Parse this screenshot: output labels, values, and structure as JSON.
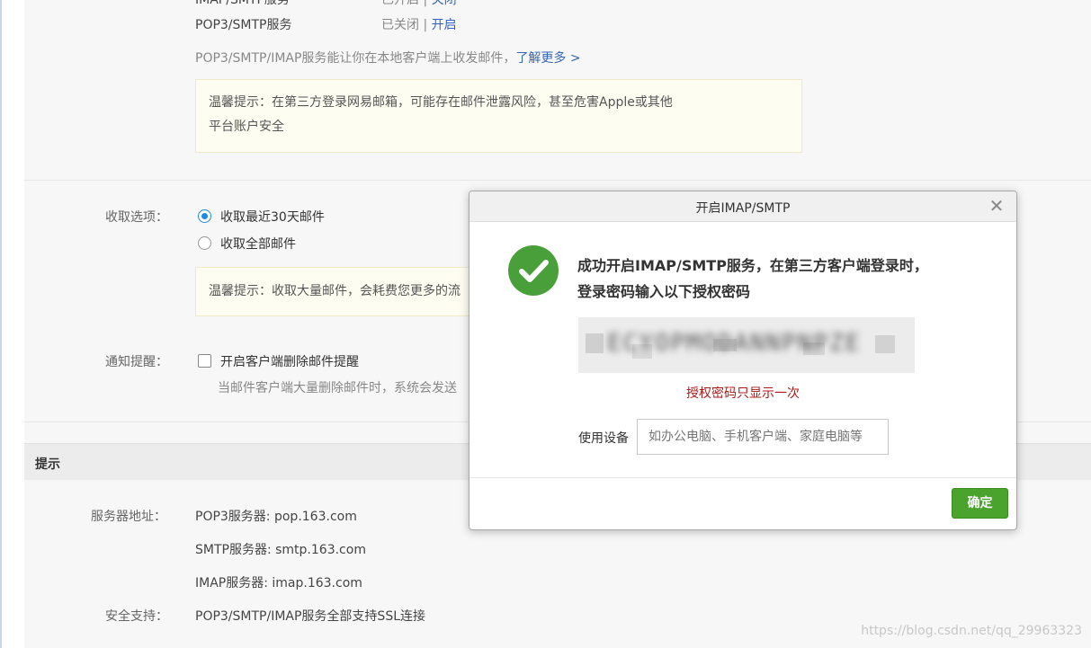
{
  "settings": {
    "partial_row": {
      "name": "IMAP/SMTP服务",
      "status": "已开启",
      "action": "关闭"
    },
    "pop3_row": {
      "name": "POP3/SMTP服务",
      "status": "已关闭",
      "divider": "|",
      "action": "开启"
    },
    "service_desc": "POP3/SMTP/IMAP服务能让你在本地客户端上收发邮件，",
    "learn_more": "了解更多 >",
    "tip1_line1": "温馨提示：在第三方登录网易邮箱，可能存在邮件泄露风险，甚至危害Apple或其他",
    "tip1_line2": "平台账户安全",
    "receive_label": "收取选项：",
    "receive_options": [
      {
        "label": "收取最近30天邮件",
        "selected": true
      },
      {
        "label": "收取全部邮件",
        "selected": false
      }
    ],
    "tip2": "温馨提示：收取大量邮件，会耗费您更多的流",
    "notify_label": "通知提醒：",
    "notify_checkbox": "开启客户端删除邮件提醒",
    "notify_desc": "当邮件客户端大量删除邮件时，系统会发送"
  },
  "hints": {
    "title": "提示",
    "server_label": "服务器地址：",
    "pop3": "POP3服务器: pop.163.com",
    "smtp": "SMTP服务器: smtp.163.com",
    "imap": "IMAP服务器: imap.163.com",
    "security_label": "安全支持：",
    "security_value": "POP3/SMTP/IMAP服务全部支持SSL连接"
  },
  "dialog": {
    "title": "开启IMAP/SMTP",
    "close_glyph": "✕",
    "message": "成功开启IMAP/SMTP服务，在第三方客户端登录时，登录密码输入以下授权密码",
    "auth_code_masked": "ECYOPMODANNPNPZE",
    "warning": "授权密码只显示一次",
    "device_label": "使用设备",
    "device_placeholder": "如办公电脑、手机客户端、家庭电脑等",
    "ok_button": "确定"
  },
  "watermark": "https://blog.csdn.net/qq_29963323",
  "colors": {
    "link": "#3366bb",
    "success": "#49a03b",
    "warning": "#b01717",
    "button": "#4aa32d",
    "radio": "#1e88e5"
  }
}
